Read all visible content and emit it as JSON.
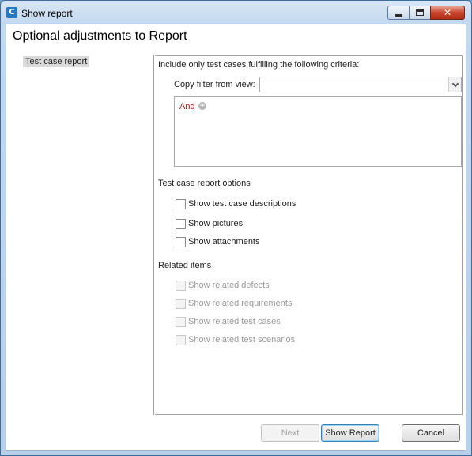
{
  "window": {
    "title": "Show report",
    "app_icon_glyph": "C",
    "close_glyph": "✕"
  },
  "dialog": {
    "heading": "Optional adjustments to Report"
  },
  "nav": {
    "items": [
      {
        "label": "Test case report",
        "selected": true
      }
    ]
  },
  "filter": {
    "intro": "Include only test cases fulfilling the following criteria:",
    "copy_from_label": "Copy filter from view:",
    "copy_from_value": "",
    "condition_operator": "And",
    "add_glyph": "+"
  },
  "report_options": {
    "heading": "Test case report options",
    "items": [
      {
        "label": "Show test case descriptions",
        "checked": false,
        "enabled": true
      },
      {
        "label": "Show pictures",
        "checked": false,
        "enabled": true
      },
      {
        "label": "Show attachments",
        "checked": false,
        "enabled": true
      }
    ]
  },
  "related_items": {
    "heading": "Related items",
    "items": [
      {
        "label": "Show related defects",
        "checked": false,
        "enabled": false
      },
      {
        "label": "Show related requirements",
        "checked": false,
        "enabled": false
      },
      {
        "label": "Show related test cases",
        "checked": false,
        "enabled": false
      },
      {
        "label": "Show related test scenarios",
        "checked": false,
        "enabled": false
      }
    ]
  },
  "footer": {
    "next_label": "Next",
    "show_report_label": "Show Report",
    "cancel_label": "Cancel"
  },
  "colors": {
    "operator": "#b01414",
    "selection": "#d9d9d9",
    "close_button": "#c9442d"
  },
  "icons": {
    "app": "app-logo-icon",
    "minimize": "minimize-icon",
    "maximize": "maximize-icon",
    "close": "close-icon",
    "dropdown": "chevron-down-icon",
    "add": "add-circle-icon"
  }
}
